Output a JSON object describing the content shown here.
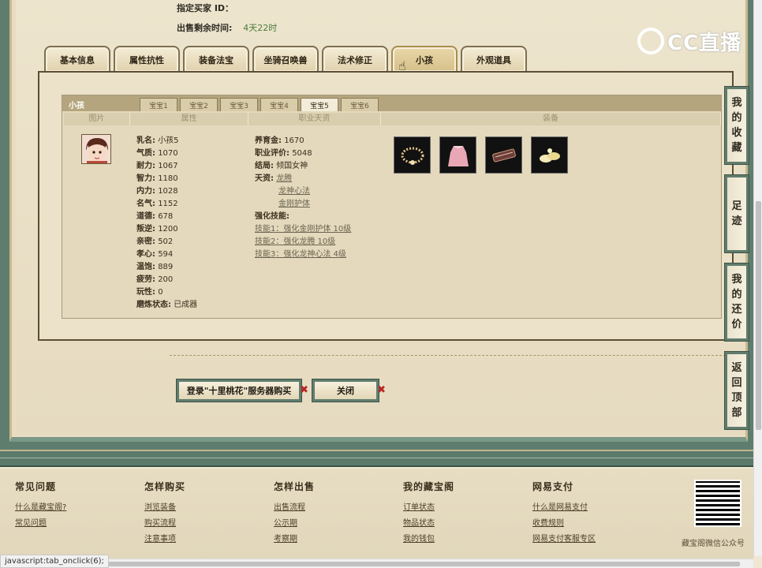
{
  "header": {
    "buyer_label": "指定买家 ID：",
    "time_label": "出售剩余时间:",
    "time_value": "4天22时"
  },
  "logo": {
    "text": "CC直播"
  },
  "main_tabs": [
    {
      "label": "基本信息"
    },
    {
      "label": "属性抗性"
    },
    {
      "label": "装备法宝"
    },
    {
      "label": "坐骑召唤兽"
    },
    {
      "label": "法术修正"
    },
    {
      "label": "小孩",
      "active": true
    },
    {
      "label": "外观道具"
    }
  ],
  "child_panel": {
    "title": "小孩",
    "sub_tabs": [
      "宝宝1",
      "宝宝2",
      "宝宝3",
      "宝宝4",
      "宝宝5",
      "宝宝6"
    ],
    "active_sub_tab": 4,
    "columns": [
      "图片",
      "属性",
      "职业天资",
      "装备"
    ],
    "attributes": [
      {
        "k": "乳名:",
        "v": "小孩5"
      },
      {
        "k": "气质:",
        "v": "1070"
      },
      {
        "k": "耐力:",
        "v": "1067"
      },
      {
        "k": "智力:",
        "v": "1180"
      },
      {
        "k": "内力:",
        "v": "1028"
      },
      {
        "k": "名气:",
        "v": "1152"
      },
      {
        "k": "道德:",
        "v": "678"
      },
      {
        "k": "叛逆:",
        "v": "1200"
      },
      {
        "k": "亲密:",
        "v": "502"
      },
      {
        "k": "孝心:",
        "v": "594"
      },
      {
        "k": "温饱:",
        "v": "889"
      },
      {
        "k": "疲劳:",
        "v": "200"
      },
      {
        "k": "玩性:",
        "v": "0"
      },
      {
        "k": "磨炼状态:",
        "v": "已成器"
      }
    ],
    "career": {
      "raise_label": "养育金:",
      "raise_value": "1670",
      "rating_label": "职业评价:",
      "rating_value": "5048",
      "ending_label": "结局:",
      "ending_value": "倾国女神",
      "talent_label": "天资:",
      "talents": [
        "龙腾",
        "龙神心法",
        "金刚护体"
      ],
      "skills_label": "强化技能:",
      "skills": [
        "技能1：强化金刚护体 10级",
        "技能2：强化龙腾 10级",
        "技能3：强化龙神心法 4级"
      ]
    },
    "equipment_icons": [
      "necklace-icon",
      "clothes-icon",
      "weapon-icon",
      "shoes-icon"
    ]
  },
  "buttons": {
    "buy": "登录\"十里桃花\"服务器购买",
    "close": "关闭"
  },
  "side_nav": [
    {
      "label": "我的收藏"
    },
    {
      "label": "足迹"
    },
    {
      "label": "我的还价"
    },
    {
      "label": "返回顶部"
    }
  ],
  "footer": {
    "cols": [
      {
        "title": "常见问题",
        "links": [
          "什么是藏宝阁?",
          "常见问题"
        ]
      },
      {
        "title": "怎样购买",
        "links": [
          "浏览装备",
          "购买流程",
          "注意事项"
        ]
      },
      {
        "title": "怎样出售",
        "links": [
          "出售流程",
          "公示期",
          "考察期"
        ]
      },
      {
        "title": "我的藏宝阁",
        "links": [
          "订单状态",
          "物品状态",
          "我的钱包"
        ]
      },
      {
        "title": "网易支付",
        "links": [
          "什么是网易支付",
          "收费规则",
          "网易支付客服专区"
        ]
      }
    ],
    "qr_label": "藏宝阁微信公众号"
  },
  "status_bar": "javascript:tab_onclick(6);"
}
